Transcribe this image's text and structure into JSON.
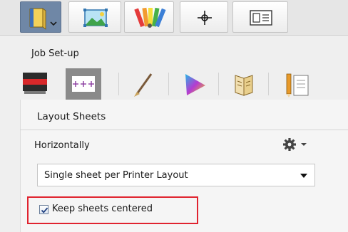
{
  "top_toolbar": {
    "buttons": [
      {
        "icon": "book-icon",
        "has_dropdown": true
      },
      {
        "icon": "image-icon"
      },
      {
        "icon": "color-swatches-icon"
      },
      {
        "icon": "crosshair-icon"
      },
      {
        "icon": "layout-view-icon"
      }
    ]
  },
  "job_setup": {
    "label": "Job Set-up",
    "categories": [
      {
        "icon": "printer-stack-icon"
      },
      {
        "icon": "layout-grid-icon",
        "active": true
      },
      {
        "icon": "brush-icon"
      },
      {
        "icon": "color-gamut-icon"
      },
      {
        "icon": "book-pages-icon"
      },
      {
        "icon": "pencil-document-icon"
      }
    ]
  },
  "panel": {
    "title": "Layout Sheets",
    "field_label": "Horizontally",
    "gear_icon": "gear-icon",
    "select": {
      "value": "Single sheet per Printer Layout"
    },
    "checkbox": {
      "label": "Keep sheets centered",
      "checked": true
    }
  },
  "colors": {
    "highlight_border": "#e0232f",
    "active_tab": "#6f87a6"
  }
}
